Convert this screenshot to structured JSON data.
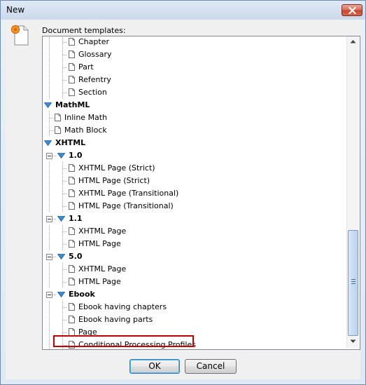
{
  "window": {
    "title": "New"
  },
  "dialog": {
    "templates_label": "Document templates:"
  },
  "tree": {
    "rows": [
      {
        "label": "Chapter",
        "bold": false,
        "kind": "page"
      },
      {
        "label": "Glossary",
        "bold": false,
        "kind": "page"
      },
      {
        "label": "Part",
        "bold": false,
        "kind": "page"
      },
      {
        "label": "Refentry",
        "bold": false,
        "kind": "page"
      },
      {
        "label": "Section",
        "bold": false,
        "kind": "page"
      },
      {
        "label": "MathML",
        "bold": true,
        "kind": "folder"
      },
      {
        "label": "Inline Math",
        "bold": false,
        "kind": "page"
      },
      {
        "label": "Math Block",
        "bold": false,
        "kind": "page"
      },
      {
        "label": "XHTML",
        "bold": true,
        "kind": "folder"
      },
      {
        "label": "1.0",
        "bold": true,
        "kind": "folder"
      },
      {
        "label": "XHTML Page (Strict)",
        "bold": false,
        "kind": "page"
      },
      {
        "label": "HTML Page (Strict)",
        "bold": false,
        "kind": "page"
      },
      {
        "label": "XHTML Page (Transitional)",
        "bold": false,
        "kind": "page"
      },
      {
        "label": "HTML Page (Transitional)",
        "bold": false,
        "kind": "page"
      },
      {
        "label": "1.1",
        "bold": true,
        "kind": "folder"
      },
      {
        "label": "XHTML Page",
        "bold": false,
        "kind": "page"
      },
      {
        "label": "HTML Page",
        "bold": false,
        "kind": "page"
      },
      {
        "label": "5.0",
        "bold": true,
        "kind": "folder"
      },
      {
        "label": "XHTML Page",
        "bold": false,
        "kind": "page"
      },
      {
        "label": "HTML Page",
        "bold": false,
        "kind": "page"
      },
      {
        "label": "Ebook",
        "bold": true,
        "kind": "folder"
      },
      {
        "label": "Ebook having chapters",
        "bold": false,
        "kind": "page"
      },
      {
        "label": "Ebook having parts",
        "bold": false,
        "kind": "page"
      },
      {
        "label": "Page",
        "bold": false,
        "kind": "page"
      },
      {
        "label": "Conditional Processing Profiles",
        "bold": false,
        "kind": "page"
      }
    ]
  },
  "buttons": {
    "ok": "OK",
    "cancel": "Cancel"
  },
  "icons": {
    "close": "close-icon",
    "new_document": "new-document-icon",
    "tree_expanded": "expanded-triangle-icon",
    "tree_collapse": "collapse-minus-icon",
    "template_page": "page-icon"
  },
  "colors": {
    "selection_outline": "#c00000",
    "expander_blue": "#3c8bd4",
    "close_button": "#c7452c"
  }
}
